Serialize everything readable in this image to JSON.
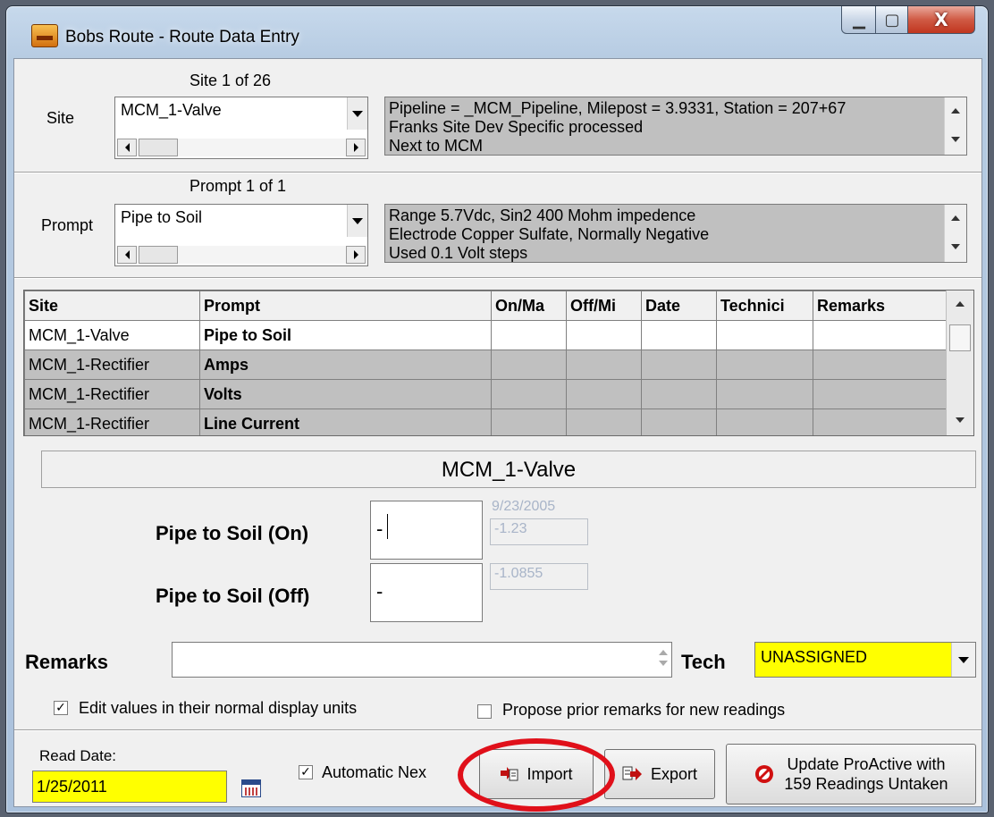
{
  "window": {
    "title": "Bobs Route - Route Data Entry",
    "controls": {
      "minimize": "▁",
      "maximize": "▢",
      "close": "X"
    }
  },
  "site": {
    "counter": "Site 1 of 26",
    "label": "Site",
    "value": "MCM_1-Valve",
    "info_lines": [
      "Pipeline = _MCM_Pipeline, Milepost = 3.9331, Station = 207+67",
      "Franks Site Dev Specific processed",
      "Next to MCM"
    ]
  },
  "prompt": {
    "counter": "Prompt 1 of 1",
    "label": "Prompt",
    "value": "Pipe to Soil",
    "info_lines": [
      "Range 5.7Vdc, Sin2 400 Mohm impedence",
      "Electrode Copper Sulfate, Normally Negative",
      "Used 0.1 Volt steps"
    ]
  },
  "grid": {
    "columns": [
      "Site",
      "Prompt",
      "On/Ma",
      "Off/Mi",
      "Date",
      "Technici",
      "Remarks"
    ],
    "rows": [
      [
        "MCM_1-Valve",
        "Pipe to Soil",
        "",
        "",
        "",
        "",
        ""
      ],
      [
        "MCM_1-Rectifier",
        "Amps",
        "",
        "",
        "",
        "",
        ""
      ],
      [
        "MCM_1-Rectifier",
        "Volts",
        "",
        "",
        "",
        "",
        ""
      ],
      [
        "MCM_1-Rectifier",
        "Line Current",
        "",
        "",
        "",
        "",
        ""
      ]
    ]
  },
  "detail": {
    "title": "MCM_1-Valve",
    "on_label": "Pipe to Soil (On)",
    "on_value": "-",
    "prior_date": "9/23/2005",
    "prior_on": "-1.23",
    "off_label": "Pipe to Soil (Off)",
    "off_value": "-",
    "prior_off": "-1.0855"
  },
  "remarks": {
    "label": "Remarks",
    "value": ""
  },
  "tech": {
    "label": "Tech",
    "value": "UNASSIGNED"
  },
  "options": {
    "edit_units_label": "Edit values in their normal display units",
    "edit_units_checked": true,
    "propose_remarks_label": "Propose prior remarks for new readings",
    "propose_remarks_checked": false
  },
  "footer": {
    "read_date_label": "Read Date:",
    "read_date": "1/25/2011",
    "automatic_next_label": "Automatic Nex",
    "automatic_next_checked": true,
    "import_label": "Import",
    "export_label": "Export",
    "update_label_line1": "Update ProActive with",
    "update_label_line2": "159 Readings Untaken"
  },
  "colors": {
    "highlight_yellow": "#ffff00",
    "annotation_red": "#e0101a",
    "grid_gray": "#c0c0c0"
  }
}
